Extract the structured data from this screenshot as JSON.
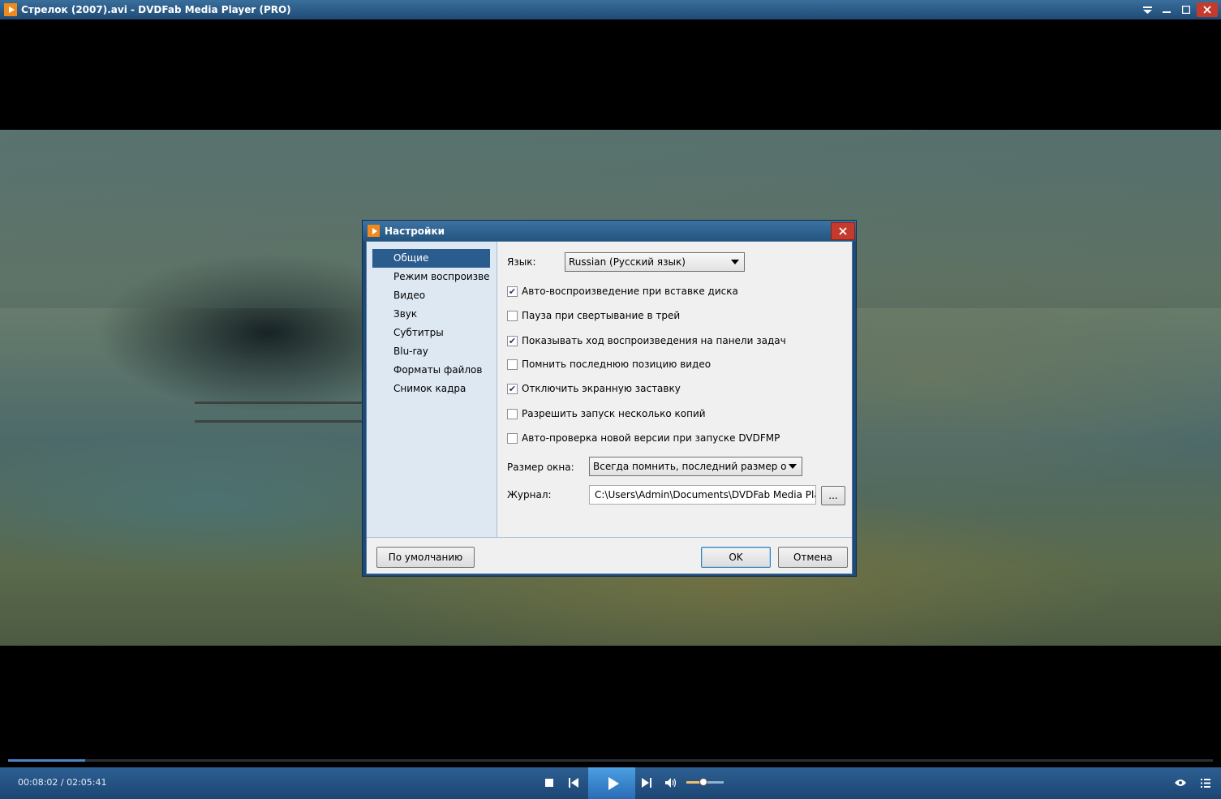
{
  "window": {
    "title": "Стрелок (2007).avi - DVDFab Media Player (PRO)",
    "icons": {
      "app": "app-logo-icon",
      "menu": "dropdown-menu-icon",
      "minimize": "minimize-icon",
      "maximize": "maximize-icon",
      "close": "close-icon"
    }
  },
  "dialog": {
    "title": "Настройки",
    "nav": [
      {
        "label": "Общие",
        "active": true
      },
      {
        "label": "Режим воспроизвед.",
        "active": false
      },
      {
        "label": "Видео",
        "active": false
      },
      {
        "label": "Звук",
        "active": false
      },
      {
        "label": "Субтитры",
        "active": false
      },
      {
        "label": "Blu-ray",
        "active": false
      },
      {
        "label": "Форматы файлов",
        "active": false
      },
      {
        "label": "Снимок кадра",
        "active": false
      }
    ],
    "language_label": "Язык:",
    "language_value": "Russian (Русский язык)",
    "options": [
      {
        "label": "Авто-воспроизведение при вставке диска",
        "checked": true
      },
      {
        "label": "Пауза при свертывание в трей",
        "checked": false
      },
      {
        "label": "Показывать ход воспроизведения на панели задач",
        "checked": true
      },
      {
        "label": "Помнить последнюю позицию видео",
        "checked": false
      },
      {
        "label": "Отключить экранную заставку",
        "checked": true
      },
      {
        "label": "Разрешить запуск несколько копий",
        "checked": false
      },
      {
        "label": "Авто-проверка новой версии при запуске DVDFMP",
        "checked": false
      }
    ],
    "window_size_label": "Размер окна:",
    "window_size_value": "Всегда помнить, последний размер окна",
    "log_label": "Журнал:",
    "log_path": "C:\\Users\\Admin\\Documents\\DVDFab Media Player",
    "browse_label": "...",
    "default_button": "По умолчанию",
    "ok_button": "OK",
    "cancel_button": "Отмена"
  },
  "player": {
    "time": "00:08:02 / 02:05:41",
    "progress_fraction": 0.0639,
    "volume_fraction": 0.45,
    "accent_color": "#4d85c5"
  }
}
